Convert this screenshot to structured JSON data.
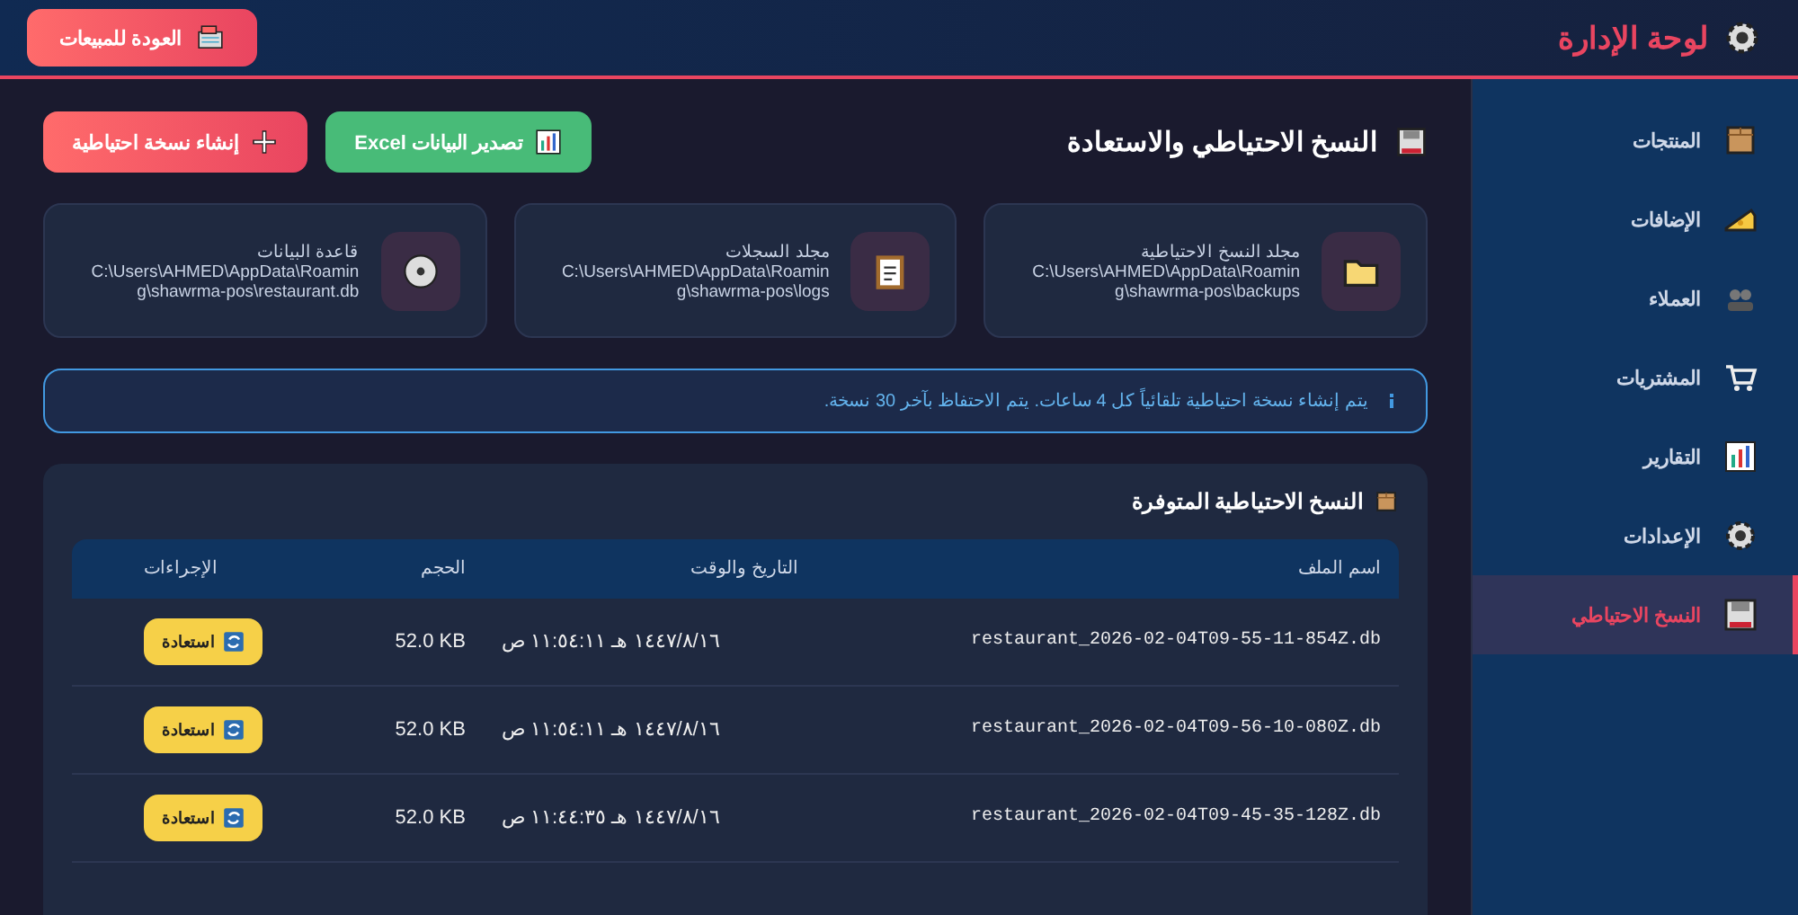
{
  "header": {
    "title": "لوحة الإدارة",
    "back_button": "العودة للمبيعات"
  },
  "sidebar": {
    "items": [
      {
        "label": "المنتجات",
        "kind": "box",
        "selected": false
      },
      {
        "label": "الإضافات",
        "kind": "cheese",
        "selected": false
      },
      {
        "label": "العملاء",
        "kind": "people",
        "selected": false
      },
      {
        "label": "المشتريات",
        "kind": "cart",
        "selected": false
      },
      {
        "label": "التقارير",
        "kind": "chart",
        "selected": false
      },
      {
        "label": "الإعدادات",
        "kind": "gear",
        "selected": false
      },
      {
        "label": "النسخ الاحتياطي",
        "kind": "floppy",
        "selected": true
      }
    ]
  },
  "page": {
    "title": "النسخ الاحتياطي والاستعادة",
    "buttons": [
      {
        "label": "تصدير البيانات Excel",
        "kind": "export"
      },
      {
        "label": "إنشاء نسخة احتياطية",
        "kind": "create"
      }
    ]
  },
  "locations": [
    {
      "label": "مجلد النسخ الاحتياطية",
      "path": "C:\\Users\\AHMED\\AppData\\Roaming\\shawrma-pos\\backups",
      "kind": "folder"
    },
    {
      "label": "مجلد السجلات",
      "path": "C:\\Users\\AHMED\\AppData\\Roaming\\shawrma-pos\\logs",
      "kind": "clipboard"
    },
    {
      "label": "قاعدة البيانات",
      "path": "C:\\Users\\AHMED\\AppData\\Roaming\\shawrma-pos\\restaurant.db",
      "kind": "disc"
    }
  ],
  "notice": "يتم إنشاء نسخة احتياطية تلقائياً كل 4 ساعات. يتم الاحتفاظ بآخر 30 نسخة.",
  "backups": {
    "title": "النسخ الاحتياطية المتوفرة",
    "columns": [
      "اسم الملف",
      "التاريخ والوقت",
      "الحجم",
      "الإجراءات"
    ],
    "rows": [
      {
        "file": "restaurant_2026-02-04T09-55-11-854Z.db",
        "date": "١٤٤٧/٨/١٦ هـ ١١:٥٤:١١ ص",
        "size": "52.0 KB",
        "action": "استعادة"
      },
      {
        "file": "restaurant_2026-02-04T09-56-10-080Z.db",
        "date": "١٤٤٧/٨/١٦ هـ ١١:٥٤:١١ ص",
        "size": "52.0 KB",
        "action": "استعادة"
      },
      {
        "file": "restaurant_2026-02-04T09-45-35-128Z.db",
        "date": "١٤٤٧/٨/١٦ هـ ١١:٤٤:٣٥ ص",
        "size": "52.0 KB",
        "action": "استعادة"
      }
    ]
  }
}
